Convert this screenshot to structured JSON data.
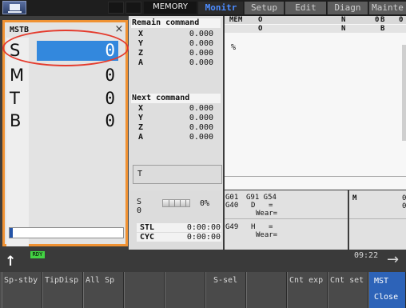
{
  "topbar": {
    "mode": "MEMORY",
    "tabs": [
      "Monitr",
      "Setup",
      "Edit",
      "Diagn",
      "Mainte"
    ],
    "active_tab": "Monitr"
  },
  "mstb": {
    "title": "MSTB",
    "close": "×",
    "rows": [
      {
        "label": "S",
        "value": "0"
      },
      {
        "label": "M",
        "value": "0"
      },
      {
        "label": "T",
        "value": "0"
      },
      {
        "label": "B",
        "value": "0"
      }
    ],
    "progress_fraction": 0.03
  },
  "remain": {
    "title": "Remain command",
    "axes": [
      {
        "axis": "X",
        "value": "0.000"
      },
      {
        "axis": "Y",
        "value": "0.000"
      },
      {
        "axis": "Z",
        "value": "0.000"
      },
      {
        "axis": "A",
        "value": "0.000"
      }
    ]
  },
  "next": {
    "title": "Next command",
    "axes": [
      {
        "axis": "X",
        "value": "0.000"
      },
      {
        "axis": "Y",
        "value": "0.000"
      },
      {
        "axis": "Z",
        "value": "0.000"
      },
      {
        "axis": "A",
        "value": "0.000"
      }
    ]
  },
  "mem": {
    "row1": {
      "a": "MEM",
      "b": "O",
      "c": "N",
      "d": "0",
      "e": "B",
      "f": "0"
    },
    "row2": {
      "b": "O",
      "c": "N",
      "e": "B"
    },
    "program": "%"
  },
  "t_line": "T",
  "spindle": {
    "s_label": "S",
    "s_value": "0",
    "load": "0%",
    "stl_label": "STL",
    "stl_time": "0:00:00",
    "cyc_label": "CYC",
    "cyc_time": "0:00:00"
  },
  "gcodes": {
    "l1a": "G01",
    "l1b": "G91 G54",
    "l2a": "G40",
    "l2b": "D",
    "l2c": "=",
    "l3": "Wear=",
    "l4a": "G49",
    "l4b": "H",
    "l4c": "=",
    "l5": "Wear="
  },
  "m_box": {
    "label": "M",
    "v1": "0",
    "v2": "0"
  },
  "status": {
    "rdy": "RDY",
    "clock": "09:22"
  },
  "softkeys": [
    "Sp-stby",
    "TipDisp",
    "All Sp",
    "",
    "",
    "S-sel",
    "",
    "Cnt exp",
    "Cnt set"
  ],
  "mst_key": {
    "line1": "MST",
    "line2": "Close"
  },
  "colors": {
    "accent": "#f09233",
    "highlight": "#e43a2c",
    "selected": "#3388dd",
    "active_tab": "#4c8cff"
  }
}
